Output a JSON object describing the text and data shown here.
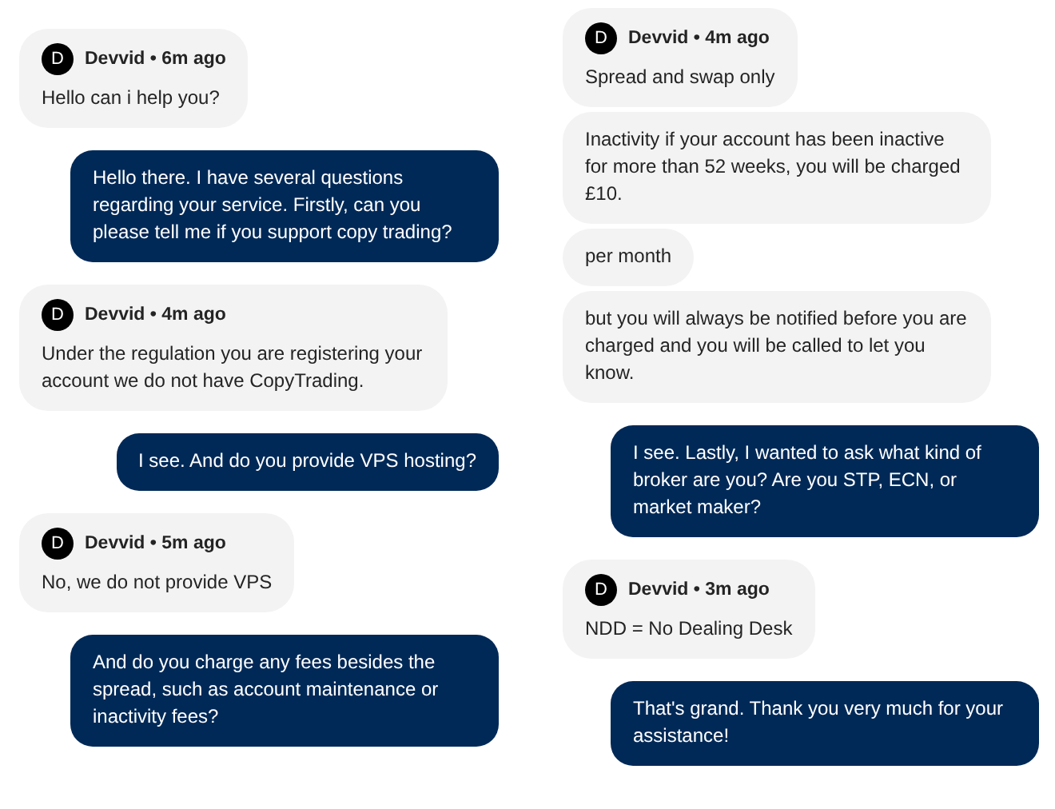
{
  "columns": [
    {
      "groups": [
        {
          "kind": "agent",
          "avatar": "D",
          "meta": "Devvid • 6m ago",
          "messages": [
            "Hello can i help you?"
          ]
        },
        {
          "kind": "user",
          "messages": [
            "Hello there. I have several questions regarding your service. Firstly, can you please tell me if you support copy trading?"
          ]
        },
        {
          "kind": "agent",
          "avatar": "D",
          "meta": "Devvid • 4m ago",
          "messages": [
            "Under the regulation you are registering your account we do not have CopyTrading."
          ]
        },
        {
          "kind": "user",
          "messages": [
            "I see. And do you provide VPS hosting?"
          ]
        },
        {
          "kind": "agent",
          "avatar": "D",
          "meta": "Devvid • 5m ago",
          "messages": [
            "No, we do not provide VPS"
          ]
        },
        {
          "kind": "user",
          "messages": [
            "And do you charge any fees besides the spread, such as account maintenance or inactivity fees?"
          ]
        }
      ]
    },
    {
      "groups": [
        {
          "kind": "agent",
          "avatar": "D",
          "meta": "Devvid • 4m ago",
          "messages": [
            "Spread and swap only",
            "Inactivity if your account has been inactive for more than 52 weeks, you will be charged £10.",
            "per month",
            "but you will always be notified before you are charged and you will be called to let you know."
          ]
        },
        {
          "kind": "user",
          "messages": [
            "I see. Lastly, I wanted to ask what kind of broker are you? Are you STP, ECN, or market maker?"
          ]
        },
        {
          "kind": "agent",
          "avatar": "D",
          "meta": "Devvid • 3m ago",
          "messages": [
            "NDD = No Dealing Desk"
          ]
        },
        {
          "kind": "user",
          "messages": [
            "That's grand. Thank you very much for your assistance!"
          ]
        }
      ]
    }
  ]
}
